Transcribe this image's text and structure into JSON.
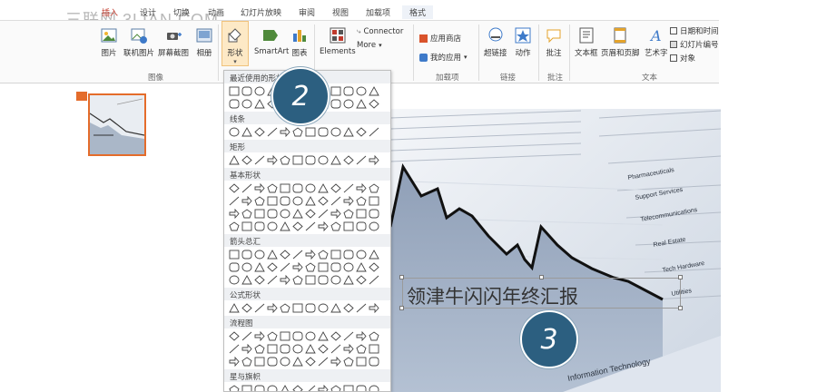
{
  "watermark": "三联网 3LIAN.COM",
  "tabs": [
    {
      "label": "插入",
      "active": true
    },
    {
      "label": "设计"
    },
    {
      "label": "切换"
    },
    {
      "label": "动画"
    },
    {
      "label": "幻灯片放映"
    },
    {
      "label": "审阅"
    },
    {
      "label": "视图"
    },
    {
      "label": "加载项"
    },
    {
      "label": "格式",
      "context": true
    }
  ],
  "ribbon": {
    "images_group": {
      "label": "图像",
      "buttons": [
        "图片",
        "联机图片",
        "屏幕截图",
        "相册"
      ]
    },
    "illustrations": {
      "shapes": "形状",
      "smartart": "SmartArt",
      "chart": "图表"
    },
    "elements": {
      "label": "Elements",
      "connector": "Connector",
      "more": "More"
    },
    "addins_group": {
      "label": "加载项",
      "store": "应用商店",
      "my_apps": "我的应用"
    },
    "links_group": {
      "label": "链接",
      "hyperlink": "超链接",
      "action": "动作"
    },
    "comments_group": {
      "label": "批注",
      "comment": "批注"
    },
    "text_group": {
      "label": "文本",
      "textbox": "文本框",
      "header_footer": "页眉和页脚",
      "wordart": "艺术字",
      "date_time": "日期和时间",
      "slide_number": "幻灯片编号",
      "object": "对象"
    }
  },
  "shapes_dropdown": {
    "sections": [
      "最近使用的形状",
      "线条",
      "矩形",
      "基本形状",
      "箭头总汇",
      "公式形状",
      "流程图",
      "星与旗帜"
    ]
  },
  "steps": {
    "two": "2",
    "three": "3"
  },
  "slide": {
    "title": "领津牛闪闪年终汇报"
  },
  "colors": {
    "accent_tab": "#c0392b",
    "step_circle": "#2c5f80",
    "thumb_border": "#e46c2b"
  }
}
